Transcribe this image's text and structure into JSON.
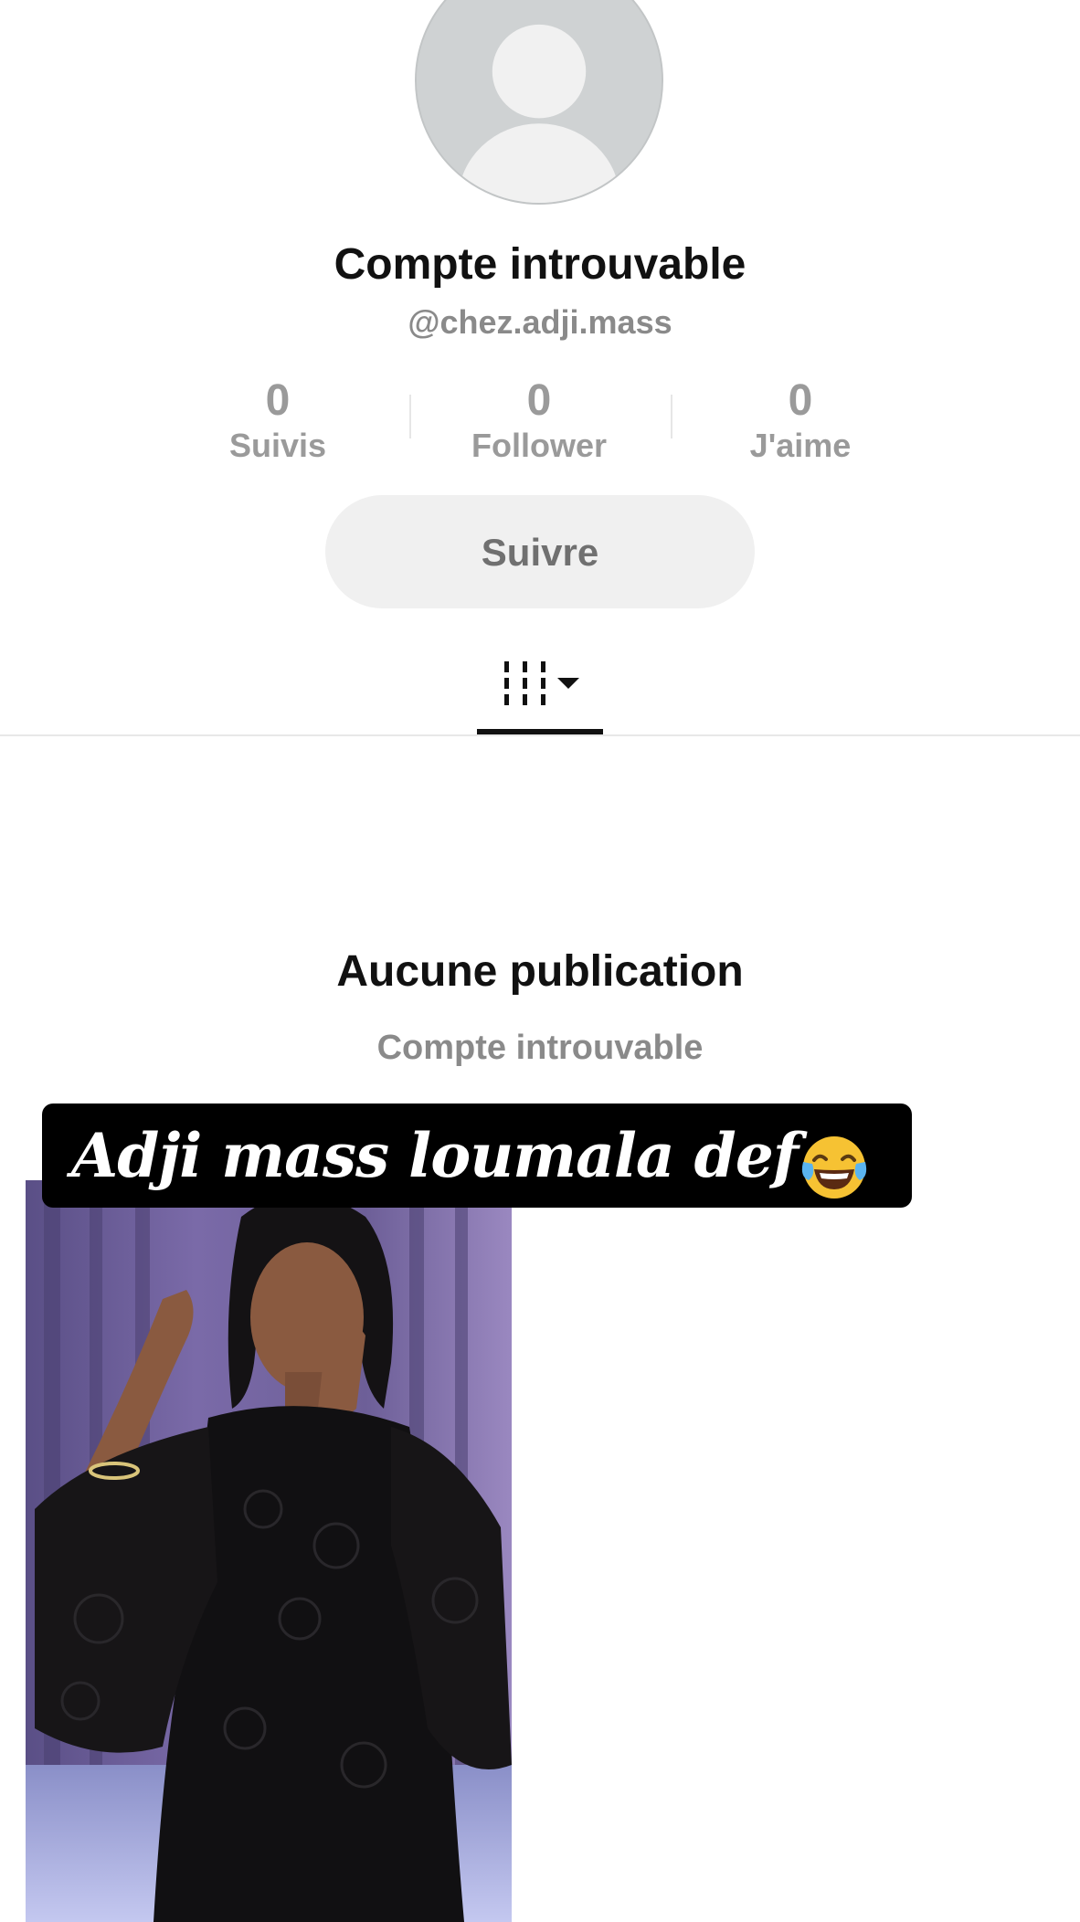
{
  "profile": {
    "title": "Compte introuvable",
    "handle": "@chez.adji.mass"
  },
  "stats": [
    {
      "value": "0",
      "label": "Suivis"
    },
    {
      "value": "0",
      "label": "Follower"
    },
    {
      "value": "0",
      "label": "J'aime"
    }
  ],
  "follow_button": {
    "label": "Suivre"
  },
  "tabs": {
    "active_icon": "grid-filter-icon",
    "dropdown_icon": "caret-down-icon"
  },
  "empty_state": {
    "title": "Aucune publication",
    "subtitle": "Compte introuvable"
  },
  "caption": {
    "text": "Adji mass loumala def",
    "emoji": "tears-of-joy-emoji"
  },
  "colors": {
    "primary_text": "#111111",
    "secondary_text": "#8a8a8a",
    "button_bg": "#f0f0f0",
    "caption_bg": "#000000"
  }
}
